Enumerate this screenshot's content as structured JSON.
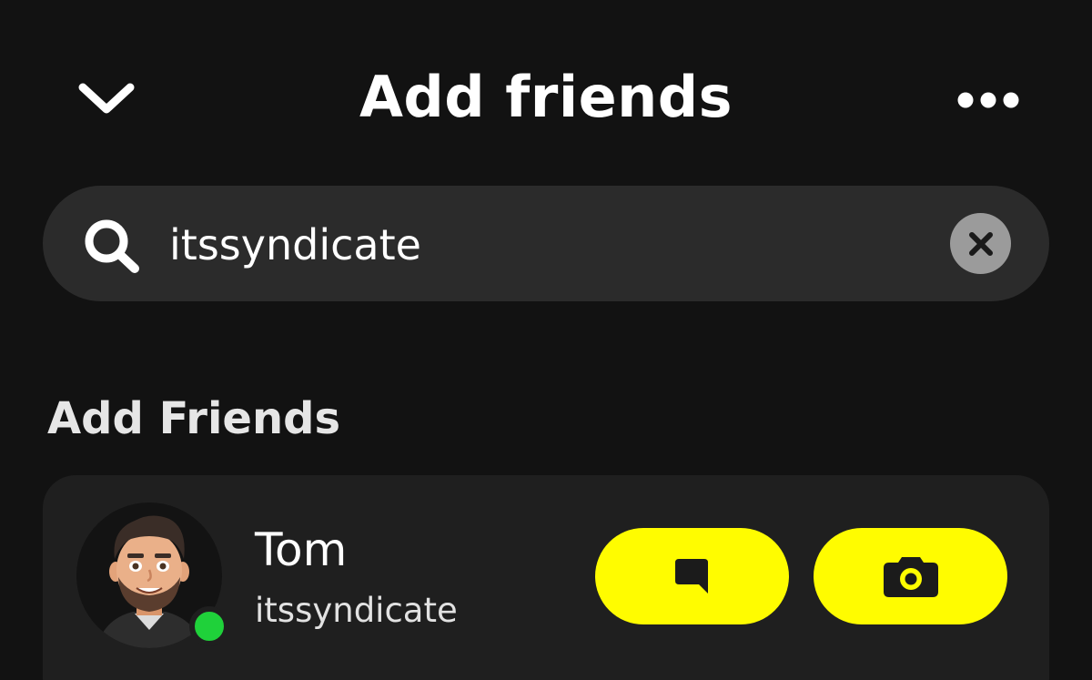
{
  "header": {
    "title": "Add friends",
    "back_icon": "chevron-down-icon",
    "more_icon": "more-dots-icon"
  },
  "search": {
    "value": "itssyndicate",
    "placeholder": "",
    "icon": "search-icon",
    "clear_icon": "clear-x-icon"
  },
  "section": {
    "title": "Add Friends"
  },
  "results": [
    {
      "name": "Tom",
      "username": "itssyndicate",
      "online": true,
      "chat_icon": "chat-bubble-icon",
      "camera_icon": "camera-icon"
    }
  ],
  "colors": {
    "background": "#121212",
    "surface": "#2b2b2b",
    "card": "#1f1f1f",
    "accent": "#fffc00",
    "online": "#1fd13a",
    "clear_button": "#9b9b9b"
  }
}
